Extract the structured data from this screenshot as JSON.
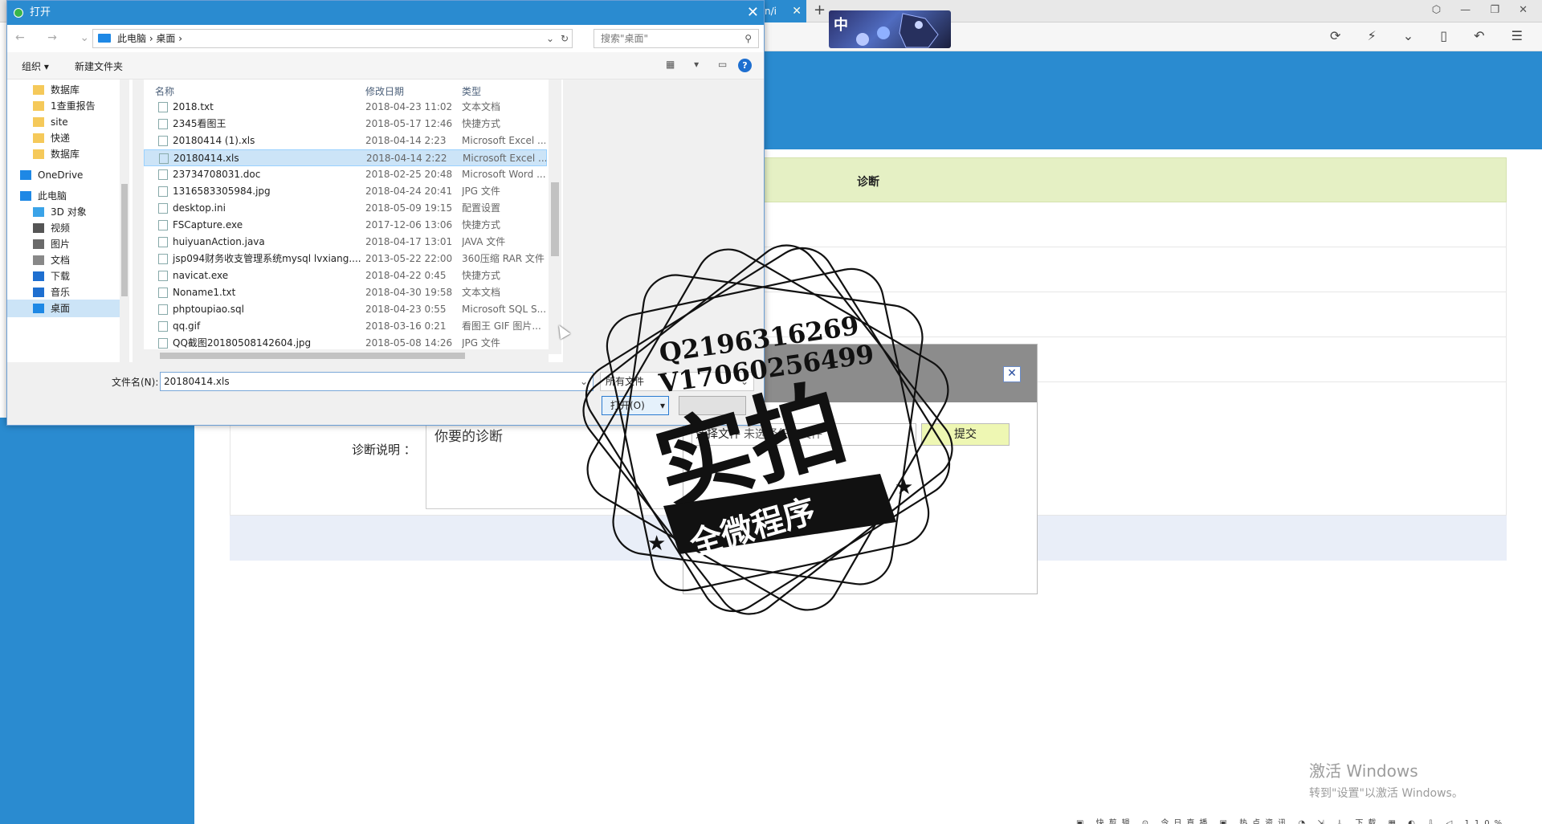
{
  "browser": {
    "tab_label": "n/i",
    "tab_close": "✕",
    "new_tab": "+",
    "banner_text": "中",
    "window_controls": "⬡ — ❐ ✕",
    "toolbar_icons": "⟳ ⚡ ⌄ ▯ ↶ ☰"
  },
  "page": {
    "table_header": "诊断",
    "diag_label": "诊断说明 ：",
    "diag_value": "你要的诊断"
  },
  "modal": {
    "close": "✕",
    "choose_file": "选择文件",
    "no_file": "未选择任何文件",
    "submit": "提交"
  },
  "dialog": {
    "title": "打开",
    "close": "✕",
    "nav": "← → ⌄ ↑",
    "breadcrumb": "此电脑  ›  桌面  ›",
    "search_placeholder": "搜索\"桌面\"",
    "organize": "组织 ▾",
    "new_folder": "新建文件夹",
    "view_icons": "▦ ▾ ▭",
    "help": "?",
    "nav_items": [
      {
        "label": "数据库",
        "icon": "folder-icon"
      },
      {
        "label": "1查重报告",
        "icon": "folder-icon"
      },
      {
        "label": "site",
        "icon": "folder-icon"
      },
      {
        "label": "快递",
        "icon": "folder-icon"
      },
      {
        "label": "数据库",
        "icon": "folder-icon"
      },
      {
        "label": "OneDrive",
        "icon": "cloud-icon"
      },
      {
        "label": "此电脑",
        "icon": "computer-icon"
      },
      {
        "label": "3D 对象",
        "icon": "cube-icon"
      },
      {
        "label": "视频",
        "icon": "video-icon"
      },
      {
        "label": "图片",
        "icon": "picture-icon"
      },
      {
        "label": "文档",
        "icon": "document-icon"
      },
      {
        "label": "下载",
        "icon": "download-icon"
      },
      {
        "label": "音乐",
        "icon": "music-icon"
      },
      {
        "label": "桌面",
        "icon": "desktop-icon"
      }
    ],
    "columns": {
      "name": "名称",
      "date": "修改日期",
      "type": "类型"
    },
    "files": [
      {
        "name": "2018.txt",
        "date": "2018-04-23 11:02",
        "type": "文本文档"
      },
      {
        "name": "2345看图王",
        "date": "2018-05-17 12:46",
        "type": "快捷方式"
      },
      {
        "name": "20180414 (1).xls",
        "date": "2018-04-14 2:23",
        "type": "Microsoft Excel ..."
      },
      {
        "name": "20180414.xls",
        "date": "2018-04-14 2:22",
        "type": "Microsoft Excel ..."
      },
      {
        "name": "23734708031.doc",
        "date": "2018-02-25 20:48",
        "type": "Microsoft Word ..."
      },
      {
        "name": "1316583305984.jpg",
        "date": "2018-04-24 20:41",
        "type": "JPG 文件"
      },
      {
        "name": "desktop.ini",
        "date": "2018-05-09 19:15",
        "type": "配置设置"
      },
      {
        "name": "FSCapture.exe",
        "date": "2017-12-06 13:06",
        "type": "快捷方式"
      },
      {
        "name": "huiyuanAction.java",
        "date": "2018-04-17 13:01",
        "type": "JAVA 文件"
      },
      {
        "name": "jsp094财务收支管理系统mysql lvxiang....",
        "date": "2013-05-22 22:00",
        "type": "360压缩 RAR 文件"
      },
      {
        "name": "navicat.exe",
        "date": "2018-04-22 0:45",
        "type": "快捷方式"
      },
      {
        "name": "Noname1.txt",
        "date": "2018-04-30 19:58",
        "type": "文本文档"
      },
      {
        "name": "phptoupiao.sql",
        "date": "2018-04-23 0:55",
        "type": "Microsoft SQL S..."
      },
      {
        "name": "qq.gif",
        "date": "2018-03-16 0:21",
        "type": "看图王 GIF 图片..."
      },
      {
        "name": "QQ截图20180508142604.jpg",
        "date": "2018-05-08 14:26",
        "type": "JPG 文件"
      }
    ],
    "selected_file": "20180414.xls",
    "filename_label": "文件名(N):",
    "filename_value": "20180414.xls",
    "file_type": "所有文件",
    "open_label": "打开(O)"
  },
  "watermark": {
    "line1": "Q2196316269",
    "line2": "V17060256499",
    "big": "实拍",
    "ribbon": "全微程序"
  },
  "activation": {
    "line1": "激活 Windows",
    "line2": "转到\"设置\"以激活 Windows。"
  },
  "taskbar": {
    "text": "▣ 快剪辑  ⊙ 今日直播  ▣ 热点资讯  ◔ ⇲ ↓ 下载 ▦ ◐ ⇩ ◁ 110%"
  },
  "colors": {
    "accent": "#2a8bd0",
    "header_green": "#e5f0c4",
    "submit_bg": "#eef7b3",
    "selection": "#cce4f7"
  }
}
